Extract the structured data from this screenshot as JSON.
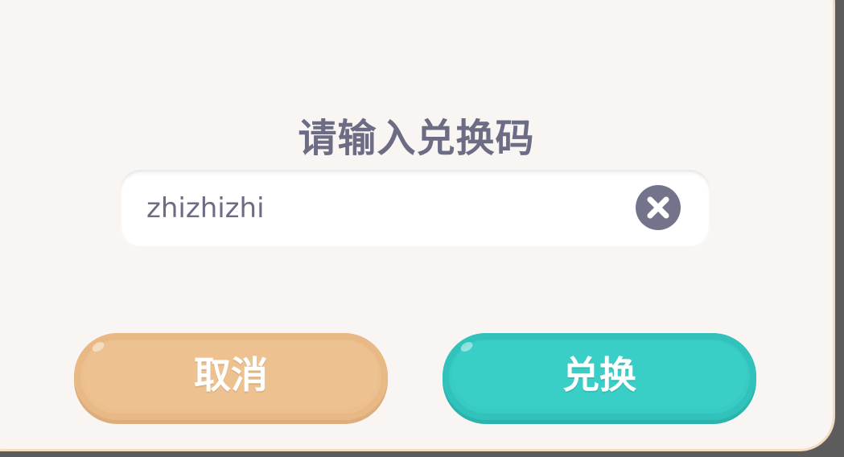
{
  "dialog": {
    "title": "请输入兑换码",
    "input": {
      "value": "zhizhizhi"
    },
    "buttons": {
      "cancel_label": "取消",
      "confirm_label": "兑换"
    }
  },
  "colors": {
    "background": "#f9f5f2",
    "border": "#f3dcc0",
    "text": "#6c6c84",
    "cancel": "#ebbf8e",
    "confirm": "#37cbc3"
  },
  "icons": {
    "clear": "close-circle-icon"
  }
}
